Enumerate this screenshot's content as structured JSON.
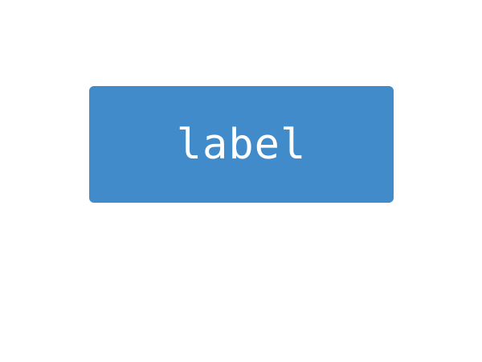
{
  "button": {
    "label": "label",
    "background_color": "#428bca",
    "text_color": "#ffffff"
  },
  "page": {
    "background_color": "#ffffff"
  }
}
